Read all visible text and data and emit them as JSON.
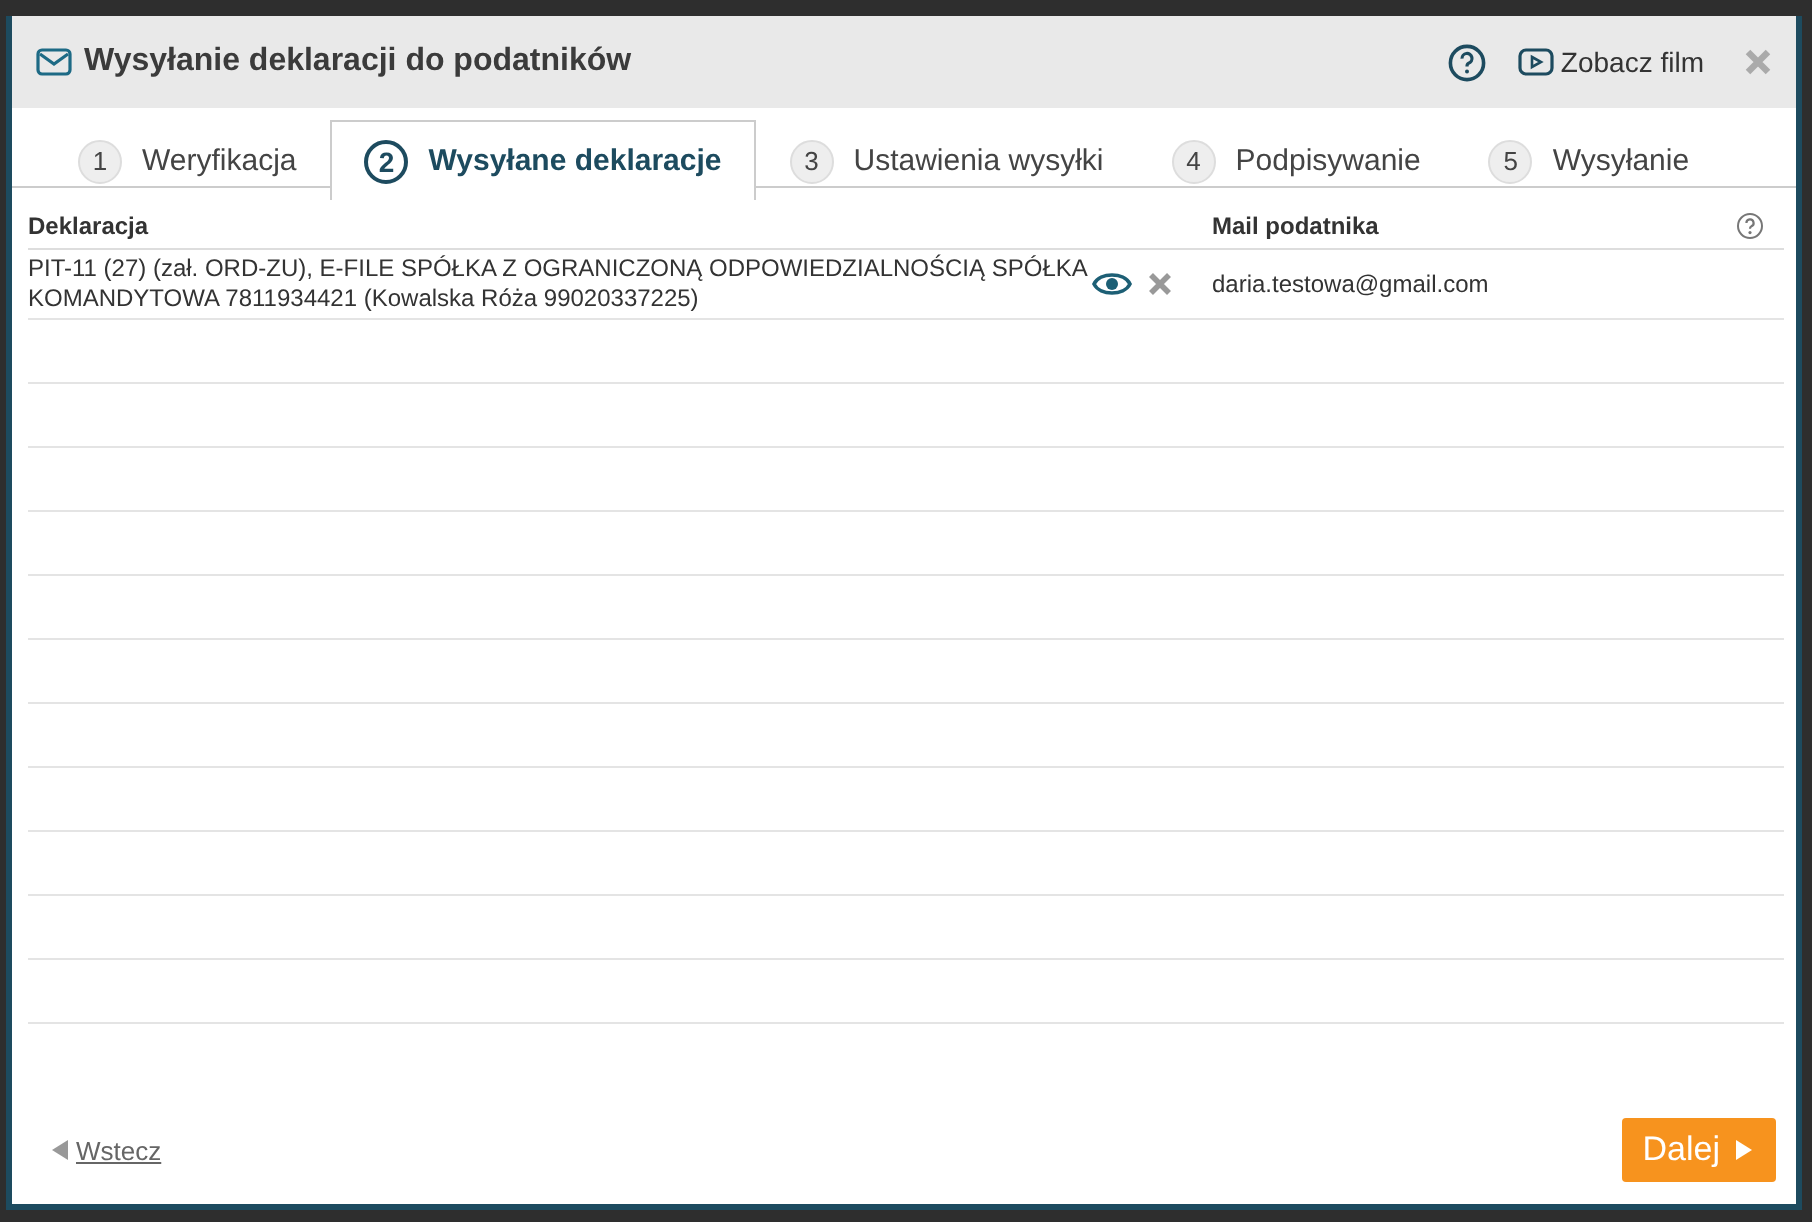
{
  "window": {
    "title": "Wysyłanie deklaracji do podatników",
    "video_link": "Zobacz film"
  },
  "steps": [
    {
      "number": "1",
      "label": "Weryfikacja",
      "selected": false
    },
    {
      "number": "2",
      "label": "Wysyłane deklaracje",
      "selected": true
    },
    {
      "number": "3",
      "label": "Ustawienia wysyłki",
      "selected": false
    },
    {
      "number": "4",
      "label": "Podpisywanie",
      "selected": false
    },
    {
      "number": "5",
      "label": "Wysyłanie",
      "selected": false
    }
  ],
  "table": {
    "columns": [
      "Deklaracja",
      "Mail podatnika"
    ],
    "rows": [
      {
        "declaration": "PIT-11 (27) (zał. ORD-ZU), E-FILE SPÓŁKA Z OGRANICZONĄ ODPOWIEDZIALNOŚCIĄ SPÓŁKA KOMANDYTOWA 7811934421 (Kowalska Róża 99020337225)",
        "email": "daria.testowa@gmail.com"
      }
    ]
  },
  "footer": {
    "back": "Wstecz",
    "next": "Dalej"
  }
}
